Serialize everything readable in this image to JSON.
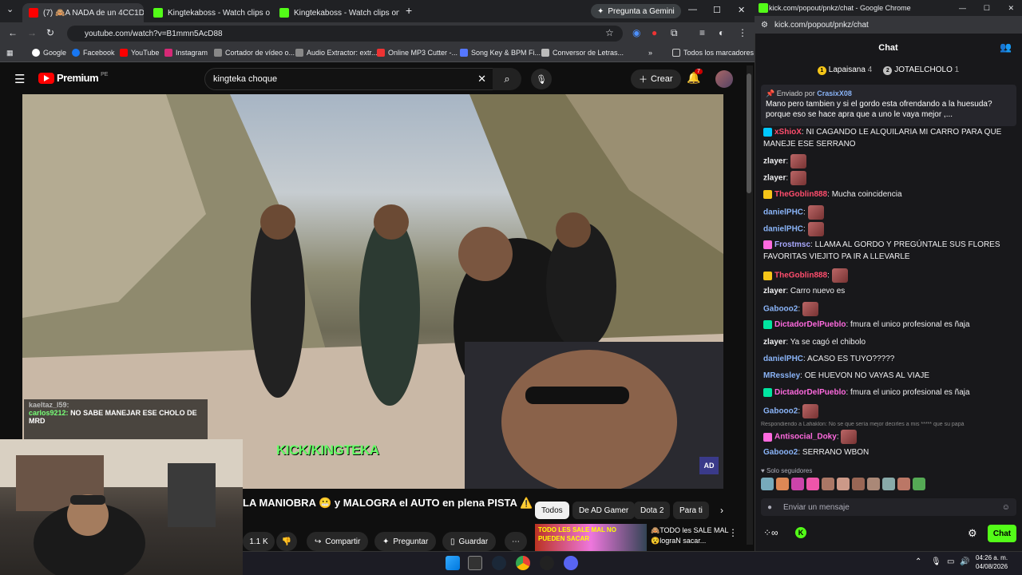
{
  "browser": {
    "tabs": [
      {
        "label": "(7) 🙈A NADA de un 4CC1D",
        "active": true,
        "favicon_color": "#ff0000"
      },
      {
        "label": "Kingtekaboss - Watch clips on K",
        "active": false,
        "favicon_color": "#53fc18"
      },
      {
        "label": "Kingtekaboss - Watch clips on K",
        "active": false,
        "favicon_color": "#53fc18"
      }
    ],
    "gemini_label": "Pregunta a Gemini",
    "url": "youtube.com/watch?v=B1mmn5AcD88",
    "bookmarks": [
      "Google",
      "Facebook",
      "YouTube",
      "Instagram",
      "Cortador de vídeo o...",
      "Audio Extractor: extr...",
      "Online MP3 Cutter -...",
      "Song Key & BPM Fi...",
      "Conversor de Letras..."
    ],
    "all_bookmarks": "Todos los marcadores"
  },
  "youtube": {
    "logo": "Premium",
    "logo_region": "PE",
    "search_value": "kingteka choque",
    "create_label": "Crear",
    "notif_count": "7",
    "video_title": "LA MANIOBRA 😬 y MALOGRA el AUTO en plena PISTA ⚠️",
    "likes": "1.1 K",
    "share": "Compartir",
    "ask": "Preguntar",
    "save": "Guardar",
    "chips": [
      "Todos",
      "De AD Gamer",
      "Dota 2",
      "Para ti"
    ],
    "video_overlay_text": "KICK/KINGTEKA",
    "overlay_chat": [
      {
        "user": "kaeltaz_l59:",
        "text": ""
      },
      {
        "user": "carlos9212:",
        "text": "NO SABE MANEJAR ESE CHOLO DE MRD"
      }
    ],
    "side_thumb_text": "TODO LES SALE MAL NO PUEDEN SACAR",
    "side_video_title": "🙈TODO les SALE MAL😵lograN sacar..."
  },
  "chat": {
    "window_title": "kick.com/popout/pnkz/chat - Google Chrome",
    "url": "kick.com/popout/pnkz/chat",
    "header": "Chat",
    "leaders": [
      {
        "name": "Lapaisana",
        "count": "4",
        "color": "#f5c518"
      },
      {
        "name": "JOTAELCHOLO",
        "count": "1",
        "color": "#c0c0c0"
      }
    ],
    "pinned_by": "Enviado por",
    "pinned_user": "CrasixX08",
    "pinned_text": "Mano pero tambien y si el gordo esta ofrendando a la huesuda? porque eso se hace apra que a uno le vaya mejor ,...",
    "messages": [
      {
        "user": "xShioX",
        "color": "#ff4d6d",
        "text": "NI CAGANDO LE ALQUILARIA MI CARRO PARA QUE MANEJE ESE SERRANO",
        "badge": "#00c8ff"
      },
      {
        "user": "zlayer",
        "color": "#efeff1",
        "text": "",
        "emote": true
      },
      {
        "user": "zlayer",
        "color": "#efeff1",
        "text": "",
        "emote": true
      },
      {
        "user": "TheGoblin888",
        "color": "#ff4d6d",
        "text": "Mucha coincidencia",
        "badge": "#f5c518"
      },
      {
        "user": "danielPHC",
        "color": "#8ab4f8",
        "text": "",
        "emote": true
      },
      {
        "user": "danielPHC",
        "color": "#8ab4f8",
        "text": "",
        "emote": true
      },
      {
        "user": "Frostmsc",
        "color": "#a9a9ff",
        "text": "LLAMA AL GORDO Y PREGÚNTALE SUS FLORES FAVORITAS VIEJITO PA IR A LLEVARLE",
        "badge": "#ff6adf"
      },
      {
        "user": "TheGoblin888",
        "color": "#ff4d6d",
        "text": "",
        "badge": "#f5c518",
        "emote": true
      },
      {
        "user": "zlayer",
        "color": "#efeff1",
        "text": "Carro nuevo es"
      },
      {
        "user": "Gabooo2",
        "color": "#8ab4f8",
        "text": "",
        "emote": true
      },
      {
        "user": "DictadorDelPueblo",
        "color": "#ff6adf",
        "text": "fmura el unico profesional es ñaja",
        "badge": "#00e5a0"
      },
      {
        "user": "zlayer",
        "color": "#efeff1",
        "text": "Ya se cagó el chibolo"
      },
      {
        "user": "danielPHC",
        "color": "#8ab4f8",
        "text": "ACASO ES TUYO?????"
      },
      {
        "user": "MRessley",
        "color": "#8ab4f8",
        "text": "OE HUEVON NO VAYAS AL VIAJE"
      },
      {
        "user": "DictadorDelPueblo",
        "color": "#ff6adf",
        "text": "fmura el unico profesional es ñaja",
        "badge": "#00e5a0"
      },
      {
        "user": "Gabooo2",
        "color": "#8ab4f8",
        "text": "",
        "emote": true
      },
      {
        "user": "Antisocial_Doky",
        "color": "#ff6adf",
        "text": "",
        "badge": "#ff6adf",
        "emote": true
      },
      {
        "user": "Gabooo2",
        "color": "#8ab4f8",
        "text": "SERRANO WBON"
      }
    ],
    "reply_note": "Respondiendo a Lafiaklon: No se que sería mejor decirles a mis ***** que su papá",
    "followers_only": "Solo seguidores",
    "input_placeholder": "Enviar un mensaje",
    "send_label": "Chat"
  },
  "taskbar": {
    "time": "04:26 a. m.",
    "date": "04/08/2026"
  }
}
